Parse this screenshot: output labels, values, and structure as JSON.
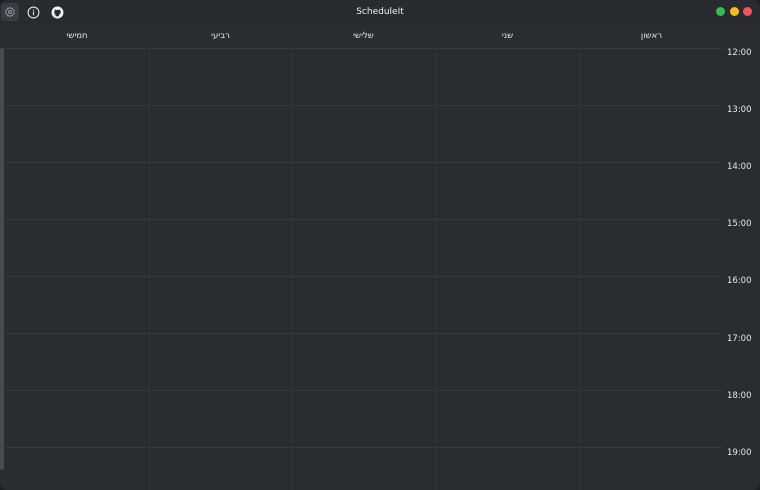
{
  "titlebar": {
    "title": "ScheduleIt",
    "icons": [
      "gear-icon",
      "info-icon",
      "github-icon"
    ],
    "window_controls": {
      "green": "#2ec04f",
      "yellow": "#f3bd1e",
      "red": "#f2545b"
    }
  },
  "days": [
    "ראשון",
    "שני",
    "שלישי",
    "רביעי",
    "חמישי"
  ],
  "times": [
    "12:00",
    "13:00",
    "14:00",
    "15:00",
    "16:00",
    "17:00",
    "18:00",
    "19:00"
  ],
  "colors": {
    "background": "#2b2c30",
    "titlebar": "#2a2b2f",
    "gridline": "#38393e",
    "text": "#e8e8e8"
  }
}
